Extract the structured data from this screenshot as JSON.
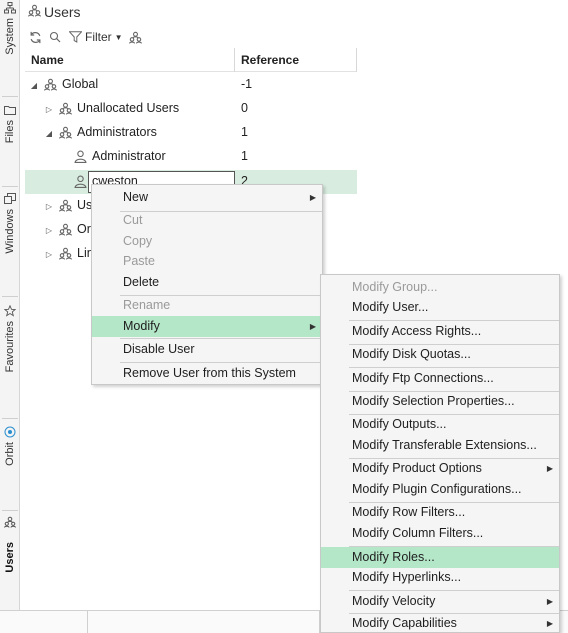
{
  "sidebar": {
    "tabs": [
      {
        "label": "System",
        "icon": "hierarchy-icon"
      },
      {
        "label": "Files",
        "icon": "folder-icon"
      },
      {
        "label": "Windows",
        "icon": "windows-icon"
      },
      {
        "label": "Favourites",
        "icon": "star-icon"
      },
      {
        "label": "Orbit",
        "icon": "orbit-icon"
      },
      {
        "label": "Users",
        "icon": "users-icon",
        "active": true
      }
    ]
  },
  "title": "Users",
  "toolbar": {
    "filter_label": "Filter"
  },
  "grid": {
    "columns": [
      "Name",
      "Reference"
    ],
    "rows": [
      {
        "name": "Global",
        "ref": "-1",
        "expanded": true,
        "kind": "group"
      },
      {
        "name": "Unallocated Users",
        "ref": "0",
        "expanded": false,
        "kind": "group"
      },
      {
        "name": "Administrators",
        "ref": "1",
        "expanded": true,
        "kind": "group"
      },
      {
        "name": "Administrator",
        "ref": "1",
        "kind": "user"
      },
      {
        "name": "cweston",
        "ref": "2",
        "kind": "user",
        "selected": true
      },
      {
        "name": "Us",
        "ref": "",
        "expanded": false,
        "kind": "group"
      },
      {
        "name": "Or",
        "ref": "",
        "expanded": false,
        "kind": "group"
      },
      {
        "name": "Lin",
        "ref": "",
        "expanded": false,
        "kind": "group"
      }
    ]
  },
  "context_menu": {
    "items": [
      {
        "label": "New",
        "submenu": true
      },
      {
        "label": "Cut",
        "disabled": true
      },
      {
        "label": "Copy",
        "disabled": true
      },
      {
        "label": "Paste",
        "disabled": true
      },
      {
        "label": "Delete"
      },
      {
        "label": "Rename",
        "disabled": true
      },
      {
        "label": "Modify",
        "submenu": true,
        "highlighted": true
      },
      {
        "label": "Disable User"
      },
      {
        "label": "Remove User from this System"
      }
    ]
  },
  "modify_menu": {
    "items": [
      {
        "label": "Modify Group...",
        "disabled": true
      },
      {
        "label": "Modify User..."
      },
      {
        "label": "Modify Access Rights..."
      },
      {
        "label": "Modify Disk Quotas..."
      },
      {
        "label": "Modify Ftp Connections..."
      },
      {
        "label": "Modify Selection Properties..."
      },
      {
        "label": "Modify Outputs..."
      },
      {
        "label": "Modify Transferable Extensions..."
      },
      {
        "label": "Modify Product Options",
        "submenu": true
      },
      {
        "label": "Modify Plugin Configurations..."
      },
      {
        "label": "Modify Row Filters..."
      },
      {
        "label": "Modify Column Filters..."
      },
      {
        "label": "Modify Roles...",
        "highlighted": true
      },
      {
        "label": "Modify Hyperlinks..."
      },
      {
        "label": "Modify Velocity",
        "submenu": true
      },
      {
        "label": "Modify Capabilities",
        "submenu": true
      }
    ]
  },
  "colors": {
    "highlight": "#b4e6c8",
    "selected_row": "#d8ece0",
    "icon": "#666666"
  }
}
